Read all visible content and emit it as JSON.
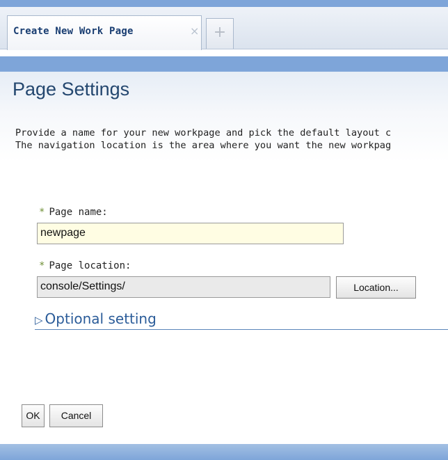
{
  "tabs": {
    "active_label": "Create New Work Page",
    "close_glyph": "×",
    "new_tab_glyph": "+"
  },
  "page": {
    "title": "Page Settings",
    "description_line1": "Provide a name for your new workpage and pick the default layout c",
    "description_line2": "The navigation location is the area where you want the new workpag"
  },
  "form": {
    "required_marker": "*",
    "page_name_label": "Page name:",
    "page_name_value": "newpage",
    "page_location_label": "Page location:",
    "page_location_value": "console/Settings/",
    "location_button": "Location...",
    "optional_toggle_glyph": "▷",
    "optional_setting_label": "Optional setting"
  },
  "actions": {
    "ok_label": "OK",
    "cancel_label": "Cancel"
  },
  "colors": {
    "accent_blue": "#7ea5d9",
    "title_text": "#24476f",
    "required_star": "#6e8f35",
    "name_field_bg": "#fffde3"
  }
}
